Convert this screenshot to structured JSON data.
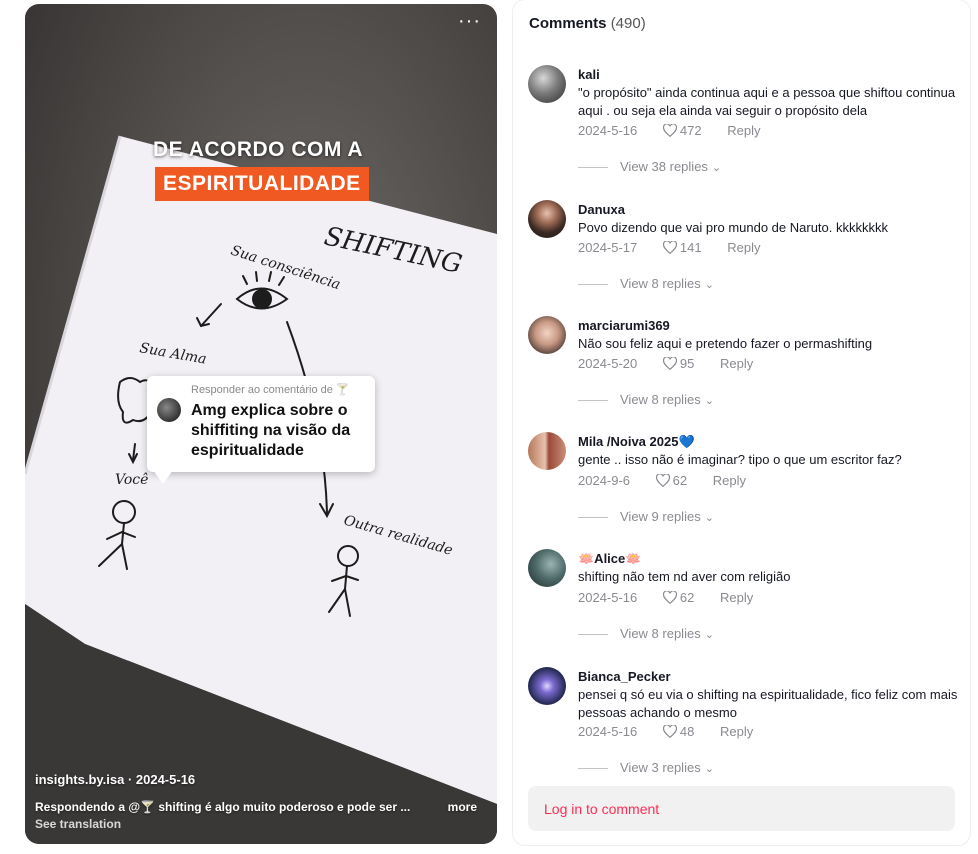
{
  "video": {
    "more_icon": "ellipsis-icon",
    "caption_line1": "DE ACORDO COM A",
    "caption_line2": "ESPIRITUALIDADE",
    "drawing_labels": {
      "title": "SHIFTING",
      "consciencia": "Sua consciência",
      "alma": "Sua Alma",
      "voce": "Você",
      "outra": "Outra realidade"
    },
    "reply_card": {
      "header": "Responder ao comentário de",
      "text": "Amg explica sobre o shiffiting na visão da espiritualidade"
    },
    "author": "insights.by.isa · 2024-5-16",
    "description": "Respondendo a @🍸 shifting é algo muito poderoso e pode ser ...",
    "more_label": "more",
    "see_translation": "See translation"
  },
  "comments_panel": {
    "title": "Comments",
    "count": "(490)",
    "comments": [
      {
        "user": "kali",
        "text": "\"o propósito\" ainda continua aqui e a pessoa que shiftou continua aqui . ou seja ela ainda vai seguir o propósito dela",
        "date": "2024-5-16",
        "likes": "472",
        "reply": "Reply",
        "view": "View 38 replies",
        "avatar_color": "#7a7a7a"
      },
      {
        "user": "Danuxa",
        "text": "Povo dizendo que vai pro mundo de Naruto. kkkkkkkk",
        "date": "2024-5-17",
        "likes": "141",
        "reply": "Reply",
        "view": "View 8 replies",
        "avatar_color": "#3b2a24"
      },
      {
        "user": "marciarumi369",
        "text": "Não sou feliz aqui e pretendo fazer o permashifting",
        "date": "2024-5-20",
        "likes": "95",
        "reply": "Reply",
        "view": "View 8 replies",
        "avatar_color": "#c99a86"
      },
      {
        "user": "Mila /Noiva 2025💙",
        "text": "gente .. isso não é imaginar? tipo o que um escritor faz?",
        "date": "2024-9-6",
        "likes": "62",
        "reply": "Reply",
        "view": "View 9 replies",
        "avatar_color": "#b5765a"
      },
      {
        "user": "🪷Alice🪷",
        "text": "shifting não tem nd aver com religião",
        "date": "2024-5-16",
        "likes": "62",
        "reply": "Reply",
        "view": "View 8 replies",
        "avatar_color": "#4f6b6a"
      },
      {
        "user": "Bianca_Pecker",
        "text": "pensei q só eu via o shifting na espiritualidade, fico feliz com mais pessoas achando o mesmo",
        "date": "2024-5-16",
        "likes": "48",
        "reply": "Reply",
        "view": "View 3 replies",
        "avatar_color": "#2a2d5a"
      }
    ],
    "login_label": "Log in to comment"
  }
}
